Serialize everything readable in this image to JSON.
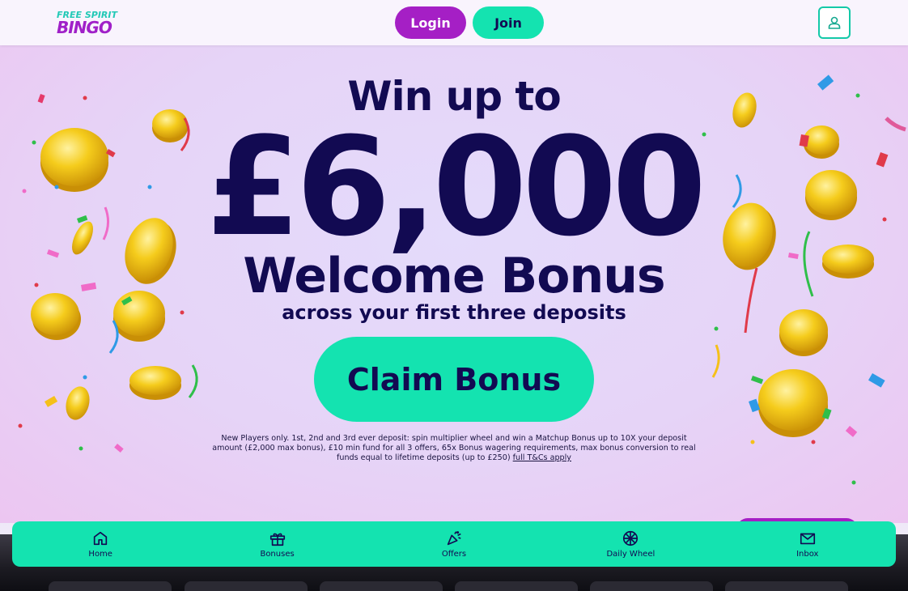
{
  "header": {
    "logo_line1": "FREE SPIRIT",
    "logo_line2": "BINGO",
    "login_label": "Login",
    "join_label": "Join",
    "account_icon": "user-icon"
  },
  "hero": {
    "headline_top": "Win up to",
    "amount": "£6,000",
    "headline_bottom": "Welcome Bonus",
    "subline": "across your first three deposits",
    "claim_label": "Claim Bonus",
    "terms_text": "New Players only. 1st, 2nd and 3rd ever deposit: spin multiplier wheel and win a Matchup Bonus up to 10X your deposit amount (£2,000 max bonus), £10 min fund for all 3 offers, 65x Bonus wagering requirements, max bonus conversion to real funds equal to lifetime deposits (up to £250)",
    "terms_link": "full T&Cs apply"
  },
  "bottom_nav": {
    "items": [
      {
        "label": "Home",
        "icon": "home-icon"
      },
      {
        "label": "Bonuses",
        "icon": "gift-icon"
      },
      {
        "label": "Offers",
        "icon": "party-popper-icon"
      },
      {
        "label": "Daily Wheel",
        "icon": "wheel-icon"
      },
      {
        "label": "Inbox",
        "icon": "envelope-icon"
      }
    ]
  },
  "colors": {
    "navy": "#120a52",
    "mint": "#14e3b0",
    "purple": "#a51fc5",
    "coin_gold": "#f2c419"
  }
}
